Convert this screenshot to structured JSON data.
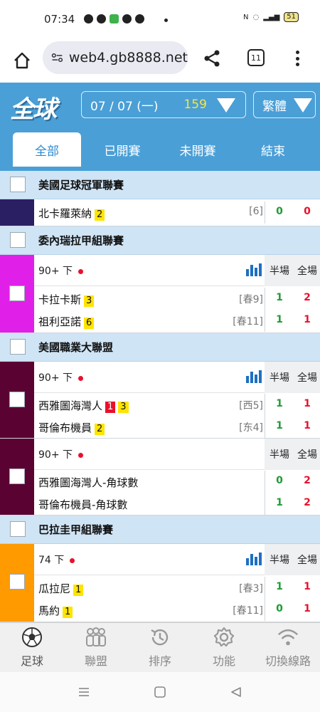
{
  "status_bar": {
    "time": "07:34",
    "battery": "51"
  },
  "browser": {
    "url": "web4.gb8888.net",
    "tab_count": "11"
  },
  "header": {
    "logo": "全球",
    "date": "07 / 07 (一)",
    "match_count": "159",
    "language": "繁體"
  },
  "filter_tabs": [
    {
      "label": "全部",
      "active": true
    },
    {
      "label": "已開賽",
      "active": false
    },
    {
      "label": "未開賽",
      "active": false
    },
    {
      "label": "結束",
      "active": false
    }
  ],
  "leagues": [
    {
      "name": "美國足球冠軍聯賽",
      "matches": [
        {
          "color": "#2a1f63",
          "teams": [
            {
              "name": "北卡羅萊納",
              "badge": "2",
              "rank": "[6]",
              "half": "0",
              "full": "0"
            }
          ]
        }
      ]
    },
    {
      "name": "委內瑞拉甲組聯賽",
      "matches": [
        {
          "color": "#e020e8",
          "status": "90+ 下",
          "half_label": "半場",
          "full_label": "全場",
          "teams": [
            {
              "name": "卡拉卡斯",
              "badge": "3",
              "rank": "[春9]",
              "half": "1",
              "full": "2"
            },
            {
              "name": "祖利亞諾",
              "badge": "6",
              "rank": "[春11]",
              "half": "1",
              "full": "1"
            }
          ]
        }
      ]
    },
    {
      "name": "美國職業大聯盟",
      "matches": [
        {
          "color": "#5a0333",
          "status": "90+ 下",
          "half_label": "半場",
          "full_label": "全場",
          "teams": [
            {
              "name": "西雅圖海灣人",
              "red_badge": "1",
              "badge": "3",
              "rank": "[西5]",
              "half": "1",
              "full": "1"
            },
            {
              "name": "哥倫布機員",
              "badge": "2",
              "rank": "[东4]",
              "half": "1",
              "full": "1"
            }
          ]
        },
        {
          "color": "#5a0333",
          "status": "90+ 下",
          "half_label": "半場",
          "full_label": "全場",
          "teams": [
            {
              "name": "西雅圖海灣人-角球數",
              "half": "0",
              "full": "2"
            },
            {
              "name": "哥倫布機員-角球數",
              "half": "1",
              "full": "2"
            }
          ]
        }
      ]
    },
    {
      "name": "巴拉圭甲組聯賽",
      "matches": [
        {
          "color": "#ff9a00",
          "status": "74 下",
          "half_label": "半場",
          "full_label": "全場",
          "teams": [
            {
              "name": "瓜拉尼",
              "badge": "1",
              "rank": "[春3]",
              "half": "1",
              "full": "1"
            },
            {
              "name": "馬約",
              "badge": "1",
              "rank": "[春11]",
              "half": "0",
              "full": "1"
            }
          ]
        }
      ]
    }
  ],
  "bottom_nav": [
    {
      "label": "足球",
      "icon": "soccer-ball-icon"
    },
    {
      "label": "聯盟",
      "icon": "league-icon"
    },
    {
      "label": "排序",
      "icon": "history-icon"
    },
    {
      "label": "功能",
      "icon": "gear-icon"
    },
    {
      "label": "切換線路",
      "icon": "wifi-icon"
    }
  ]
}
